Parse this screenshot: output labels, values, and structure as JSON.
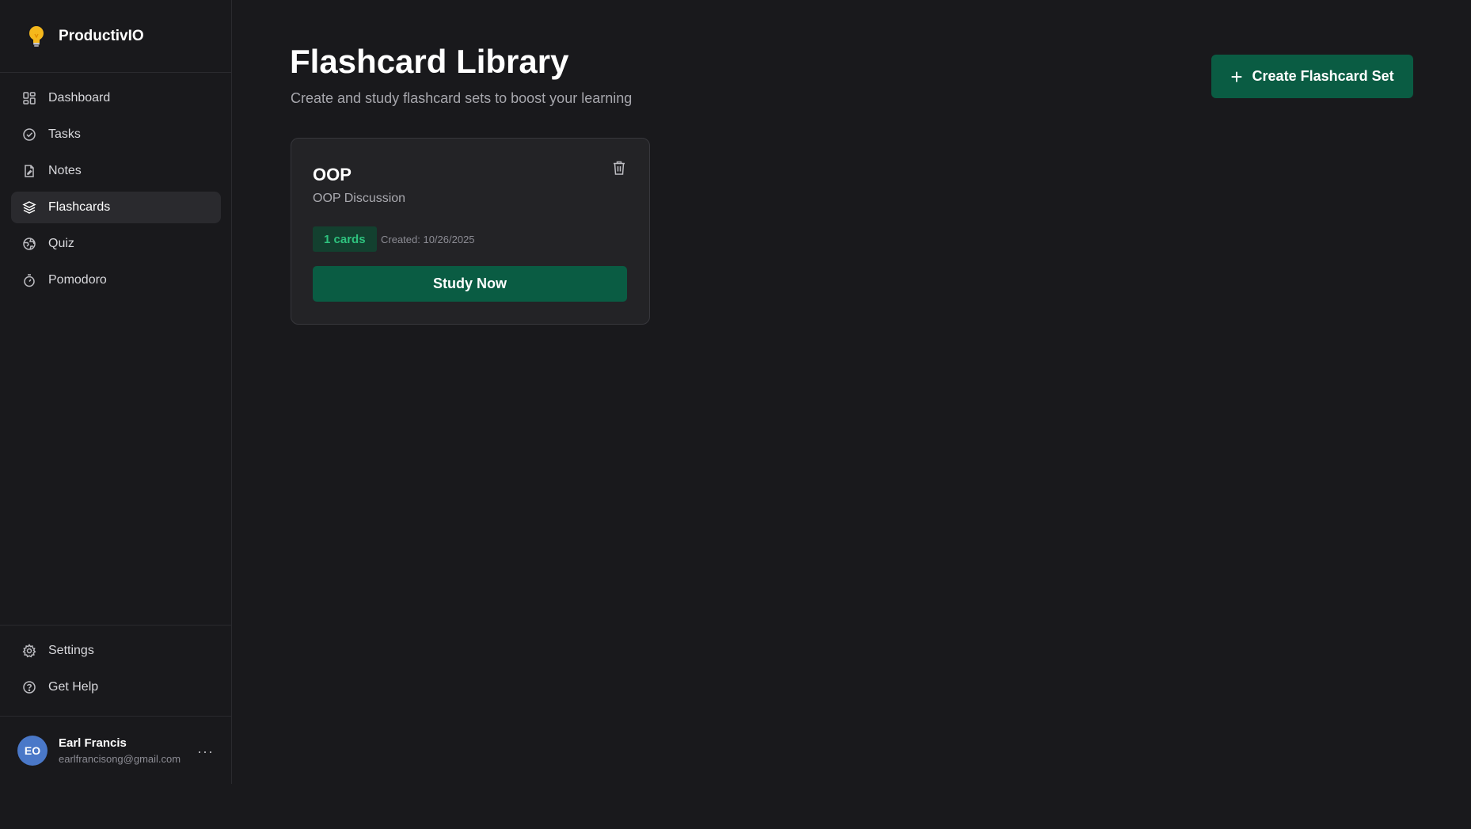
{
  "brand": {
    "name": "ProductivIO",
    "icon": "lightbulb-icon"
  },
  "nav": {
    "items": [
      {
        "label": "Dashboard",
        "icon": "dashboard-icon"
      },
      {
        "label": "Tasks",
        "icon": "check-circle-icon"
      },
      {
        "label": "Notes",
        "icon": "notes-icon"
      },
      {
        "label": "Flashcards",
        "icon": "layers-icon",
        "active": true
      },
      {
        "label": "Quiz",
        "icon": "globe-icon"
      },
      {
        "label": "Pomodoro",
        "icon": "timer-icon"
      }
    ],
    "bottom": [
      {
        "label": "Settings",
        "icon": "gear-icon"
      },
      {
        "label": "Get Help",
        "icon": "help-circle-icon"
      }
    ]
  },
  "user": {
    "initials": "EO",
    "name": "Earl Francis",
    "email": "earlfrancisong@gmail.com",
    "menu": "···"
  },
  "header": {
    "title": "Flashcard Library",
    "subtitle": "Create and study flashcard sets to boost your learning",
    "create_button": "Create Flashcard Set",
    "create_icon": "+"
  },
  "cards": [
    {
      "title": "OOP",
      "description": "OOP Discussion",
      "count_badge": "1 cards",
      "created": "Created: 10/26/2025",
      "study_button": "Study Now"
    }
  ],
  "colors": {
    "background": "#19191c",
    "accent": "#0a5c43",
    "badge_text": "#2ec27e",
    "avatar": "#4a78c8"
  }
}
